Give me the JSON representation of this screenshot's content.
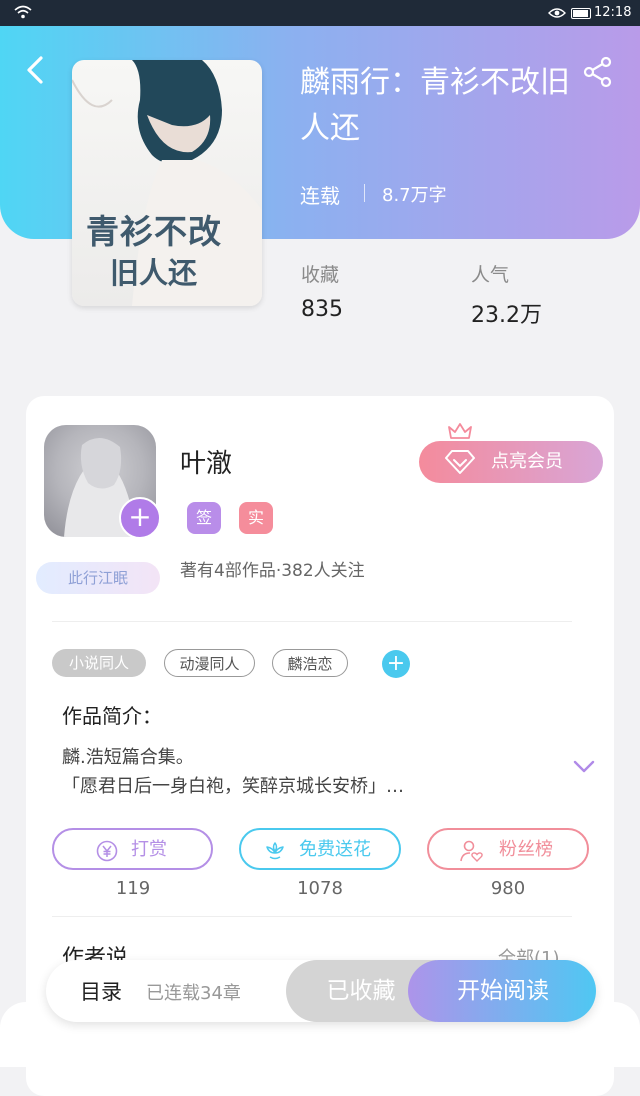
{
  "status_bar": {
    "time": "12:18",
    "wifi_icon": "wifi-icon",
    "eye_icon": "eye-icon",
    "battery_icon": "battery-icon"
  },
  "book": {
    "title": "麟雨行：青衫不改旧人还",
    "status": "连载",
    "word_count": "8.7万字",
    "cover_text_1": "青衫不改",
    "cover_text_2": "旧人还"
  },
  "stats": [
    {
      "label": "收藏",
      "value": "835"
    },
    {
      "label": "人气",
      "value": "23.2万"
    }
  ],
  "author": {
    "name": "叶澈",
    "badge_sign": "签",
    "badge_real": "实",
    "flair": "此行江眠",
    "info": "著有4部作品·382人关注",
    "vip_button": "点亮会员"
  },
  "tags": [
    "小说同人",
    "动漫同人",
    "麟浩恋"
  ],
  "intro": {
    "heading": "作品简介：",
    "line1": "麟.浩短篇合集。",
    "line2": "「愿君日后一身白袍，笑醉京城长安桥」…"
  },
  "actions": [
    {
      "label": "打赏",
      "count": "119",
      "icon": "yen-coin-icon",
      "color": "#b48fe6"
    },
    {
      "label": "免费送花",
      "count": "1078",
      "icon": "flower-icon",
      "color": "#4ac9ee"
    },
    {
      "label": "粉丝榜",
      "count": "980",
      "icon": "user-heart-icon",
      "color": "#f18e9a"
    }
  ],
  "author_notes": {
    "heading": "作者说",
    "more": "全部(1)"
  },
  "bottom_bar": {
    "toc": "目录",
    "toc_status": "已连载34章",
    "collected": "已收藏",
    "start_reading": "开始阅读"
  },
  "colors": {
    "header_start": "#4fd6f4",
    "header_end": "#b99be9",
    "accent_purple": "#b07be8",
    "accent_blue": "#4ac9ee",
    "accent_pink": "#f18e9a"
  }
}
